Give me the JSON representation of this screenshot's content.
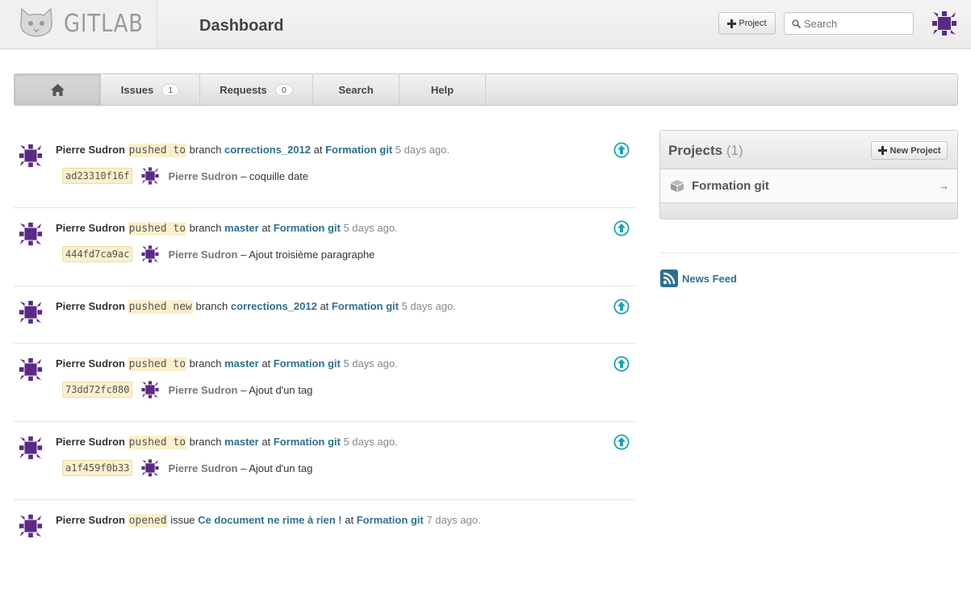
{
  "header": {
    "logo_text": "GITLAB",
    "page_title": "Dashboard",
    "project_button": "Project",
    "search_placeholder": "Search"
  },
  "nav": {
    "home_icon": "home-icon",
    "items": [
      {
        "label": "Issues",
        "badge": "1"
      },
      {
        "label": "Requests",
        "badge": "0"
      },
      {
        "label": "Search"
      },
      {
        "label": "Help"
      }
    ]
  },
  "events": [
    {
      "author": "Pierre Sudron",
      "action": "pushed to",
      "kind": "branch",
      "target": "corrections_2012",
      "at": "at",
      "project": "Formation git",
      "time": "5 days ago.",
      "sha": "ad23310f16f",
      "commit_author": "Pierre Sudron",
      "commit_message": "– coquille date",
      "icon": "push-up-icon"
    },
    {
      "author": "Pierre Sudron",
      "action": "pushed to",
      "kind": "branch",
      "target": "master",
      "at": "at",
      "project": "Formation git",
      "time": "5 days ago.",
      "sha": "444fd7ca9ac",
      "commit_author": "Pierre Sudron",
      "commit_message": "– Ajout troisième paragraphe",
      "icon": "push-up-icon"
    },
    {
      "author": "Pierre Sudron",
      "action": "pushed new",
      "kind": "branch",
      "target": "corrections_2012",
      "at": "at",
      "project": "Formation git",
      "time": "5 days ago.",
      "icon": "push-up-icon"
    },
    {
      "author": "Pierre Sudron",
      "action": "pushed to",
      "kind": "branch",
      "target": "master",
      "at": "at",
      "project": "Formation git",
      "time": "5 days ago.",
      "sha": "73dd72fc880",
      "commit_author": "Pierre Sudron",
      "commit_message": "– Ajout d'un tag",
      "icon": "push-up-icon"
    },
    {
      "author": "Pierre Sudron",
      "action": "pushed to",
      "kind": "branch",
      "target": "master",
      "at": "at",
      "project": "Formation git",
      "time": "5 days ago.",
      "sha": "a1f459f0b33",
      "commit_author": "Pierre Sudron",
      "commit_message": "– Ajout d'un tag",
      "icon": "push-up-icon"
    },
    {
      "author": "Pierre Sudron",
      "action": "opened",
      "kind": "issue",
      "target": "Ce document ne rime à rien !",
      "at": "at",
      "project": "Formation git",
      "time": "7 days ago."
    }
  ],
  "sidebar": {
    "projects_title": "Projects",
    "projects_count": "(1)",
    "new_project_button": "New Project",
    "projects": [
      {
        "name": "Formation git",
        "arrow": "→"
      }
    ],
    "news_feed": "News Feed"
  },
  "colors": {
    "link": "#2f6f8f",
    "highlight": "#fcf0cc",
    "avatar": "#5b2a86",
    "push_icon": "#1aa3b3"
  }
}
